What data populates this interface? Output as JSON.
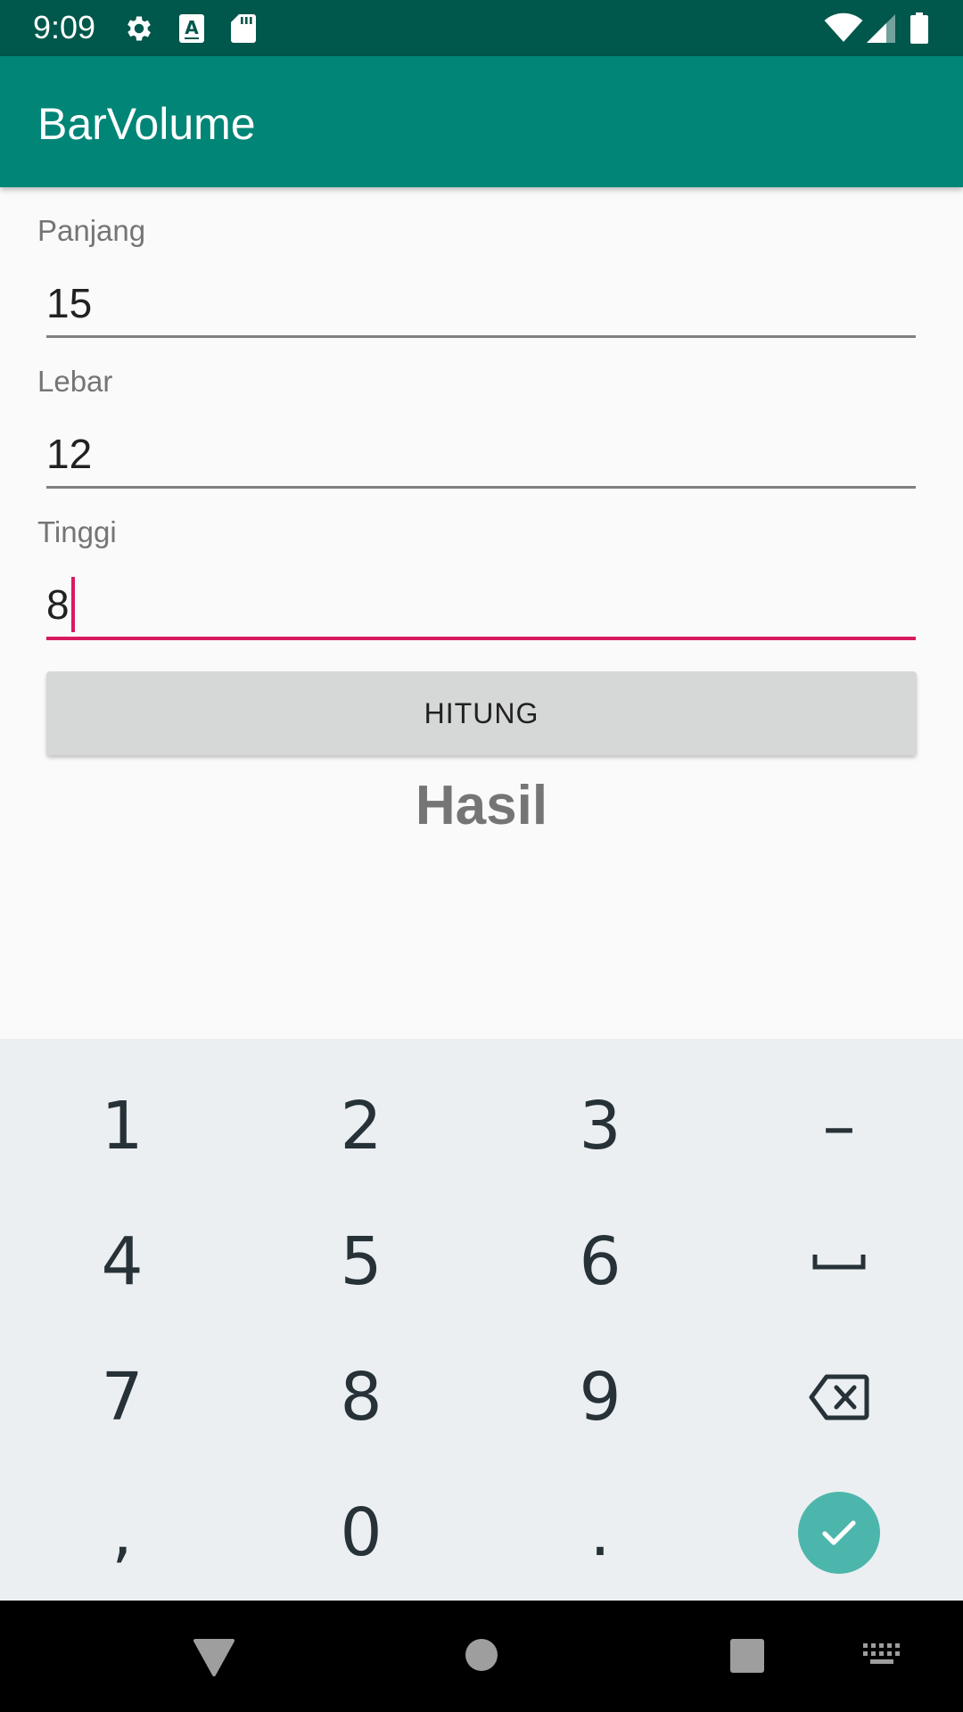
{
  "status_bar": {
    "time": "9:09",
    "icons": [
      "settings-icon",
      "text-a-icon",
      "sd-card-icon",
      "wifi-icon",
      "signal-icon",
      "battery-icon"
    ]
  },
  "app_bar": {
    "title": "BarVolume",
    "color": "#008577"
  },
  "form": {
    "panjang": {
      "label": "Panjang",
      "value": "15"
    },
    "lebar": {
      "label": "Lebar",
      "value": "12"
    },
    "tinggi": {
      "label": "Tinggi",
      "value": "8"
    },
    "button_label": "HITUNG",
    "result_label": "Hasil",
    "accent_color": "#d81b60"
  },
  "keyboard": {
    "rows": [
      [
        "1",
        "2",
        "3",
        "–"
      ],
      [
        "4",
        "5",
        "6",
        "space"
      ],
      [
        "7",
        "8",
        "9",
        "backspace"
      ],
      [
        ",",
        "0",
        ".",
        "done"
      ]
    ],
    "done_color": "#4db6ac"
  },
  "nav_bar": {
    "buttons": [
      "back-icon",
      "home-icon",
      "recents-icon",
      "keyboard-switch-icon"
    ]
  }
}
